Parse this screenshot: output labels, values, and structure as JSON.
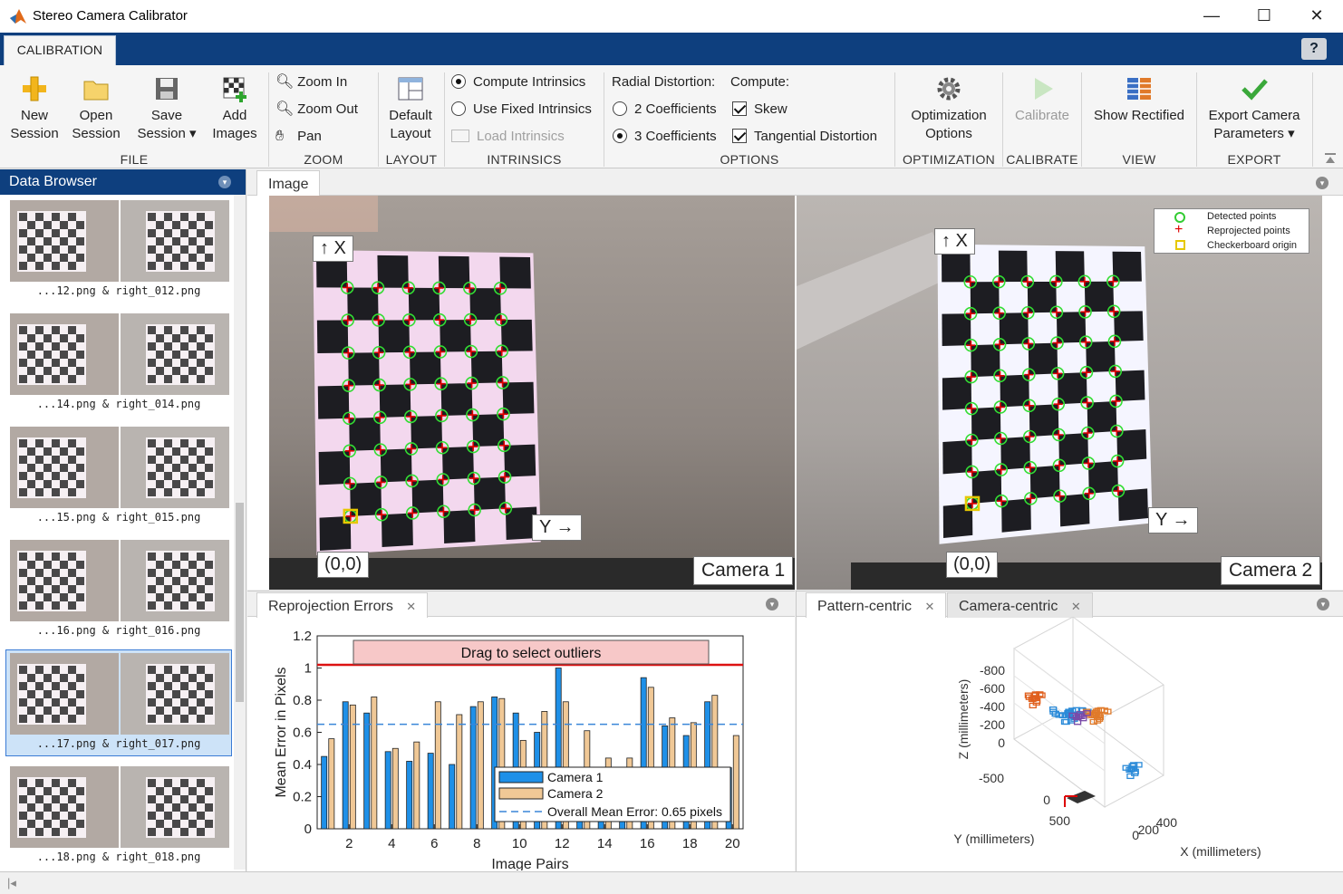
{
  "window": {
    "title": "Stereo Camera Calibrator",
    "controls": [
      "—",
      "☐",
      "✕"
    ]
  },
  "toolstrip": {
    "tab": "CALIBRATION",
    "help": "?"
  },
  "file": {
    "section": "FILE",
    "new_l1": "New",
    "new_l2": "Session",
    "open_l1": "Open",
    "open_l2": "Session",
    "save_l1": "Save",
    "save_l2": "Session ▾",
    "add_l1": "Add",
    "add_l2": "Images"
  },
  "zoom": {
    "section": "ZOOM",
    "zoom_in": "Zoom In",
    "zoom_out": "Zoom Out",
    "pan": "Pan"
  },
  "layout": {
    "section": "LAYOUT",
    "default_l1": "Default",
    "default_l2": "Layout"
  },
  "intrinsics": {
    "section": "INTRINSICS",
    "compute": "Compute Intrinsics",
    "fixed": "Use Fixed Intrinsics",
    "load": "Load Intrinsics"
  },
  "options": {
    "section": "OPTIONS",
    "radial_label": "Radial Distortion:",
    "compute_label": "Compute:",
    "two_coef": "2 Coefficients",
    "three_coef": "3 Coefficients",
    "skew": "Skew",
    "tangential": "Tangential Distortion"
  },
  "optimization": {
    "section": "OPTIMIZATION",
    "l1": "Optimization",
    "l2": "Options"
  },
  "calibrate": {
    "section": "CALIBRATE",
    "label": "Calibrate"
  },
  "view": {
    "section": "VIEW",
    "label": "Show Rectified"
  },
  "export": {
    "section": "EXPORT",
    "l1": "Export Camera",
    "l2": "Parameters ▾"
  },
  "data_browser": {
    "title": "Data Browser",
    "items": [
      {
        "caption": "...12.png & right_012.png"
      },
      {
        "caption": "...14.png & right_014.png"
      },
      {
        "caption": "...15.png & right_015.png"
      },
      {
        "caption": "...16.png & right_016.png"
      },
      {
        "caption": "...17.png & right_017.png"
      },
      {
        "caption": "...18.png & right_018.png"
      }
    ],
    "selected_index": 4
  },
  "image_panel": {
    "tab": "Image",
    "legend": [
      "Detected points",
      "Reprojected points",
      "Checkerboard origin"
    ],
    "camera1": "Camera 1",
    "camera2": "Camera 2",
    "x_arrow": "↑ X",
    "y_arrow": "Y →",
    "origin": "(0,0)"
  },
  "reprojection": {
    "tab": "Reprojection Errors",
    "drag_label": "Drag to select outliers",
    "chart_data": {
      "type": "bar",
      "xlabel": "Image Pairs",
      "ylabel": "Mean Error in Pixels",
      "ylim": [
        0,
        1.2
      ],
      "yticks": [
        "0",
        "0.2",
        "0.4",
        "0.6",
        "0.8",
        "1",
        "1.2"
      ],
      "xticks": [
        "2",
        "4",
        "6",
        "8",
        "10",
        "12",
        "14",
        "16",
        "18",
        "20"
      ],
      "categories": [
        1,
        2,
        3,
        4,
        5,
        6,
        7,
        8,
        9,
        10,
        11,
        12,
        13,
        14,
        15,
        16,
        17,
        18,
        19,
        20
      ],
      "series": [
        {
          "name": "Camera 1",
          "color": "#1e90e8",
          "values": [
            0.45,
            0.79,
            0.72,
            0.48,
            0.42,
            0.47,
            0.4,
            0.76,
            0.82,
            0.72,
            0.6,
            1.0,
            0.31,
            0.06,
            0.3,
            0.94,
            0.64,
            0.58,
            0.79,
            0.38
          ]
        },
        {
          "name": "Camera 2",
          "color": "#f0c896",
          "values": [
            0.56,
            0.77,
            0.82,
            0.5,
            0.54,
            0.79,
            0.71,
            0.79,
            0.81,
            0.55,
            0.73,
            0.79,
            0.61,
            0.44,
            0.44,
            0.88,
            0.69,
            0.66,
            0.83,
            0.58
          ]
        }
      ],
      "mean_line": 0.65,
      "mean_label": "Overall Mean Error: 0.65 pixels",
      "threshold": 1.02,
      "legend": [
        "Camera 1",
        "Camera 2",
        "Overall Mean Error: 0.65 pixels"
      ]
    }
  },
  "extrinsics": {
    "tab_pattern": "Pattern-centric",
    "tab_camera": "Camera-centric",
    "zlabel": "Z (millimeters)",
    "ylabel": "Y (millimeters)",
    "xlabel": "X (millimeters)",
    "zticks": [
      "-800",
      "-600",
      "-400",
      "-200",
      "0"
    ],
    "yticks": [
      "-500",
      "0",
      "500"
    ],
    "xticks": [
      "0",
      "200",
      "400"
    ]
  }
}
